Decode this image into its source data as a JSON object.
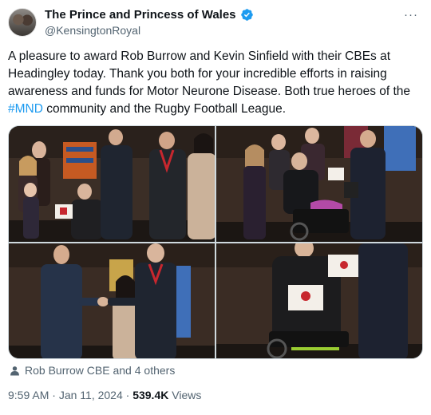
{
  "account": {
    "display_name": "The Prince and Princess of Wales",
    "handle": "@KensingtonRoyal",
    "verified_color": "#1d9bf0"
  },
  "tweet": {
    "text_before": "A pleasure to award Rob Burrow and Kevin Sinfield with their CBEs at Headingley today. Thank you both for your incredible efforts in raising awareness and funds for Motor Neurone Disease. Both true heroes of the ",
    "hashtag": "#MND",
    "text_after": " community and the Rugby Football League."
  },
  "tagged": {
    "label": "Rob Burrow CBE and 4 others",
    "icon": "person-icon"
  },
  "meta": {
    "time": "9:59 AM",
    "separator": "·",
    "date": "Jan 11, 2024",
    "views_count": "539.4K",
    "views_label": "Views"
  },
  "more_icon": "···",
  "colors": {
    "link": "#1d9bf0",
    "secondary_text": "#536471",
    "primary_text": "#0f1419"
  }
}
